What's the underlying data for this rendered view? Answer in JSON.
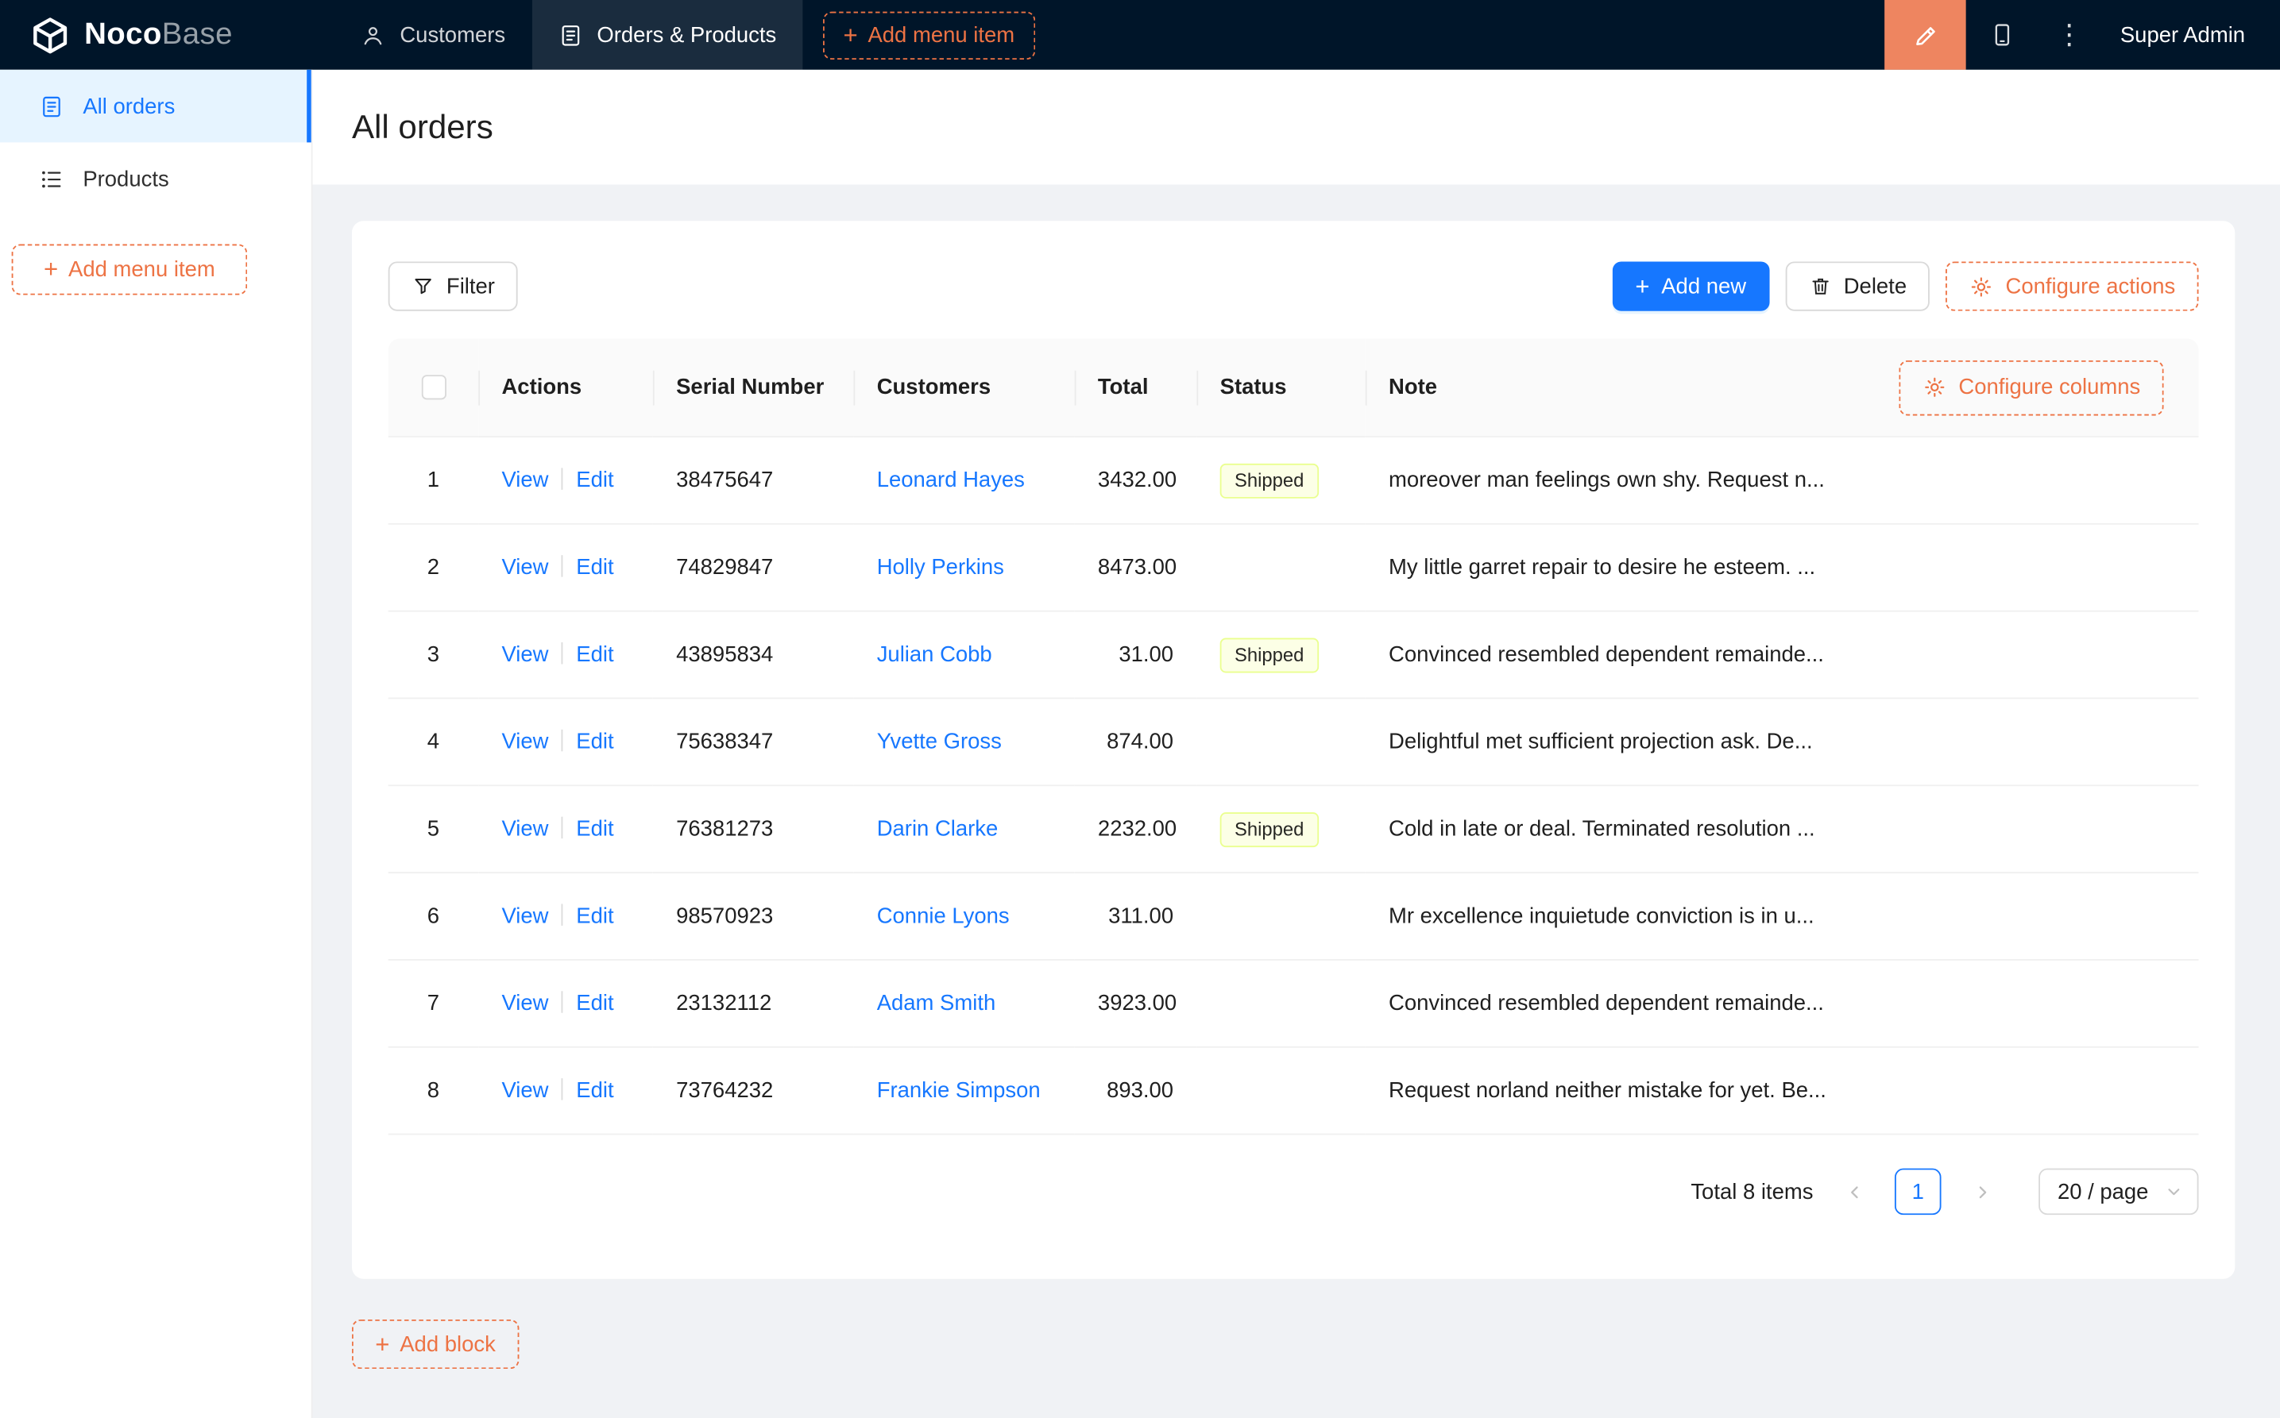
{
  "colors": {
    "header_bg": "#001529",
    "accent_orange": "#ed7344",
    "design_button_bg": "#ee8560",
    "primary_blue": "#1677ff",
    "sidebar_active_bg": "#e6f4ff",
    "status_tag_bg": "#fcffe6",
    "status_tag_border": "#eaff8f"
  },
  "icons": {
    "plus": "+",
    "kebab": "⋮"
  },
  "header": {
    "logo_bold": "Noco",
    "logo_light": "Base",
    "nav": [
      {
        "label": "Customers"
      },
      {
        "label": "Orders & Products"
      }
    ],
    "add_menu_item_label": "Add menu item",
    "user_name": "Super Admin"
  },
  "sidebar": {
    "items": [
      {
        "label": "All orders"
      },
      {
        "label": "Products"
      }
    ],
    "add_menu_item_label": "Add menu item"
  },
  "page": {
    "title": "All orders"
  },
  "toolbar": {
    "filter_label": "Filter",
    "add_new_label": "Add new",
    "delete_label": "Delete",
    "configure_actions_label": "Configure actions"
  },
  "table": {
    "columns": [
      "Actions",
      "Serial Number",
      "Customers",
      "Total",
      "Status",
      "Note"
    ],
    "configure_columns_label": "Configure columns",
    "actions": {
      "view": "View",
      "edit": "Edit"
    },
    "rows": [
      {
        "index": "1",
        "serial": "38475647",
        "customer": "Leonard Hayes",
        "total": "3432.00",
        "status": "Shipped",
        "note": "moreover man feelings own shy. Request n..."
      },
      {
        "index": "2",
        "serial": "74829847",
        "customer": "Holly Perkins",
        "total": "8473.00",
        "status": "",
        "note": "My little garret repair to desire he esteem. ..."
      },
      {
        "index": "3",
        "serial": "43895834",
        "customer": "Julian Cobb",
        "total": "31.00",
        "status": "Shipped",
        "note": "Convinced resembled dependent remainde..."
      },
      {
        "index": "4",
        "serial": "75638347",
        "customer": "Yvette Gross",
        "total": "874.00",
        "status": "",
        "note": "Delightful met sufficient projection ask. De..."
      },
      {
        "index": "5",
        "serial": "76381273",
        "customer": "Darin Clarke",
        "total": "2232.00",
        "status": "Shipped",
        "note": "Cold in late or deal. Terminated resolution ..."
      },
      {
        "index": "6",
        "serial": "98570923",
        "customer": "Connie Lyons",
        "total": "311.00",
        "status": "",
        "note": "Mr excellence inquietude conviction is in u..."
      },
      {
        "index": "7",
        "serial": "23132112",
        "customer": "Adam Smith",
        "total": "3923.00",
        "status": "",
        "note": "Convinced resembled dependent remainde..."
      },
      {
        "index": "8",
        "serial": "73764232",
        "customer": "Frankie Simpson",
        "total": "893.00",
        "status": "",
        "note": "Request norland neither mistake for yet. Be..."
      }
    ]
  },
  "pagination": {
    "total_label": "Total 8 items",
    "current_page": "1",
    "page_size": "20 / page"
  },
  "add_block_label": "Add block"
}
